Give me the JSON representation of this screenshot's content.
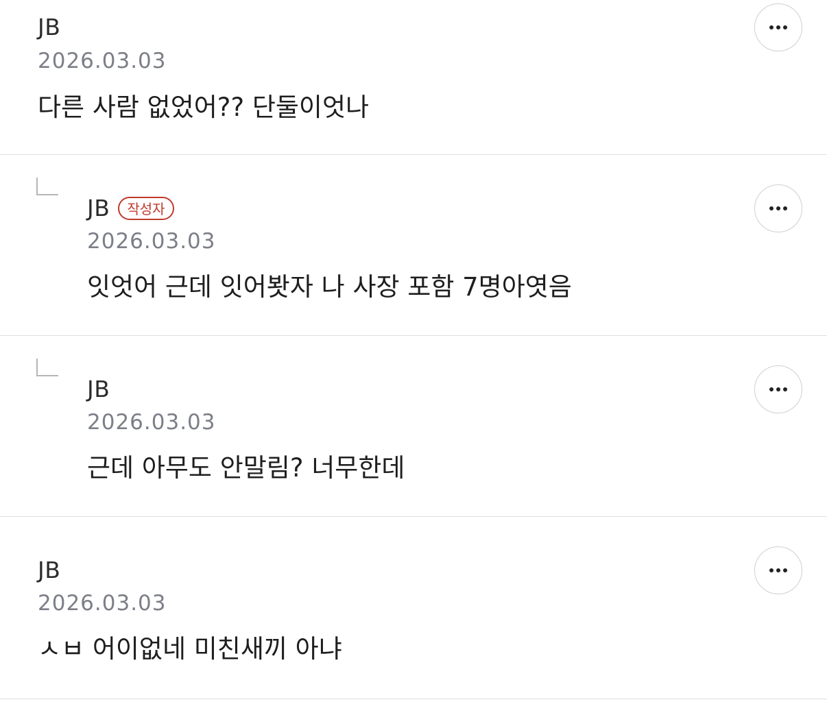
{
  "comments": [
    {
      "author": "JB",
      "date": "2026.03.03",
      "text": "다른 사람 없었어?? 단둘이엇나",
      "is_reply": false
    },
    {
      "author": "JB",
      "badge": "작성자",
      "date": "2026.03.03",
      "text": "잇엇어 근데 잇어봣자 나 사장 포함 7명아엿음",
      "is_reply": true
    },
    {
      "author": "JB",
      "date": "2026.03.03",
      "text": "근데 아무도 안말림? 너무한데",
      "is_reply": true
    },
    {
      "author": "JB",
      "date": "2026.03.03",
      "text": "ㅅㅂ 어이없네 미친새끼 아냐",
      "is_reply": false
    }
  ],
  "colors": {
    "badge": "#c0392b",
    "date": "#7c7f87",
    "divider": "#dedede"
  },
  "icons": {
    "more": "more-dots-icon",
    "reply": "reply-arrow-icon"
  }
}
